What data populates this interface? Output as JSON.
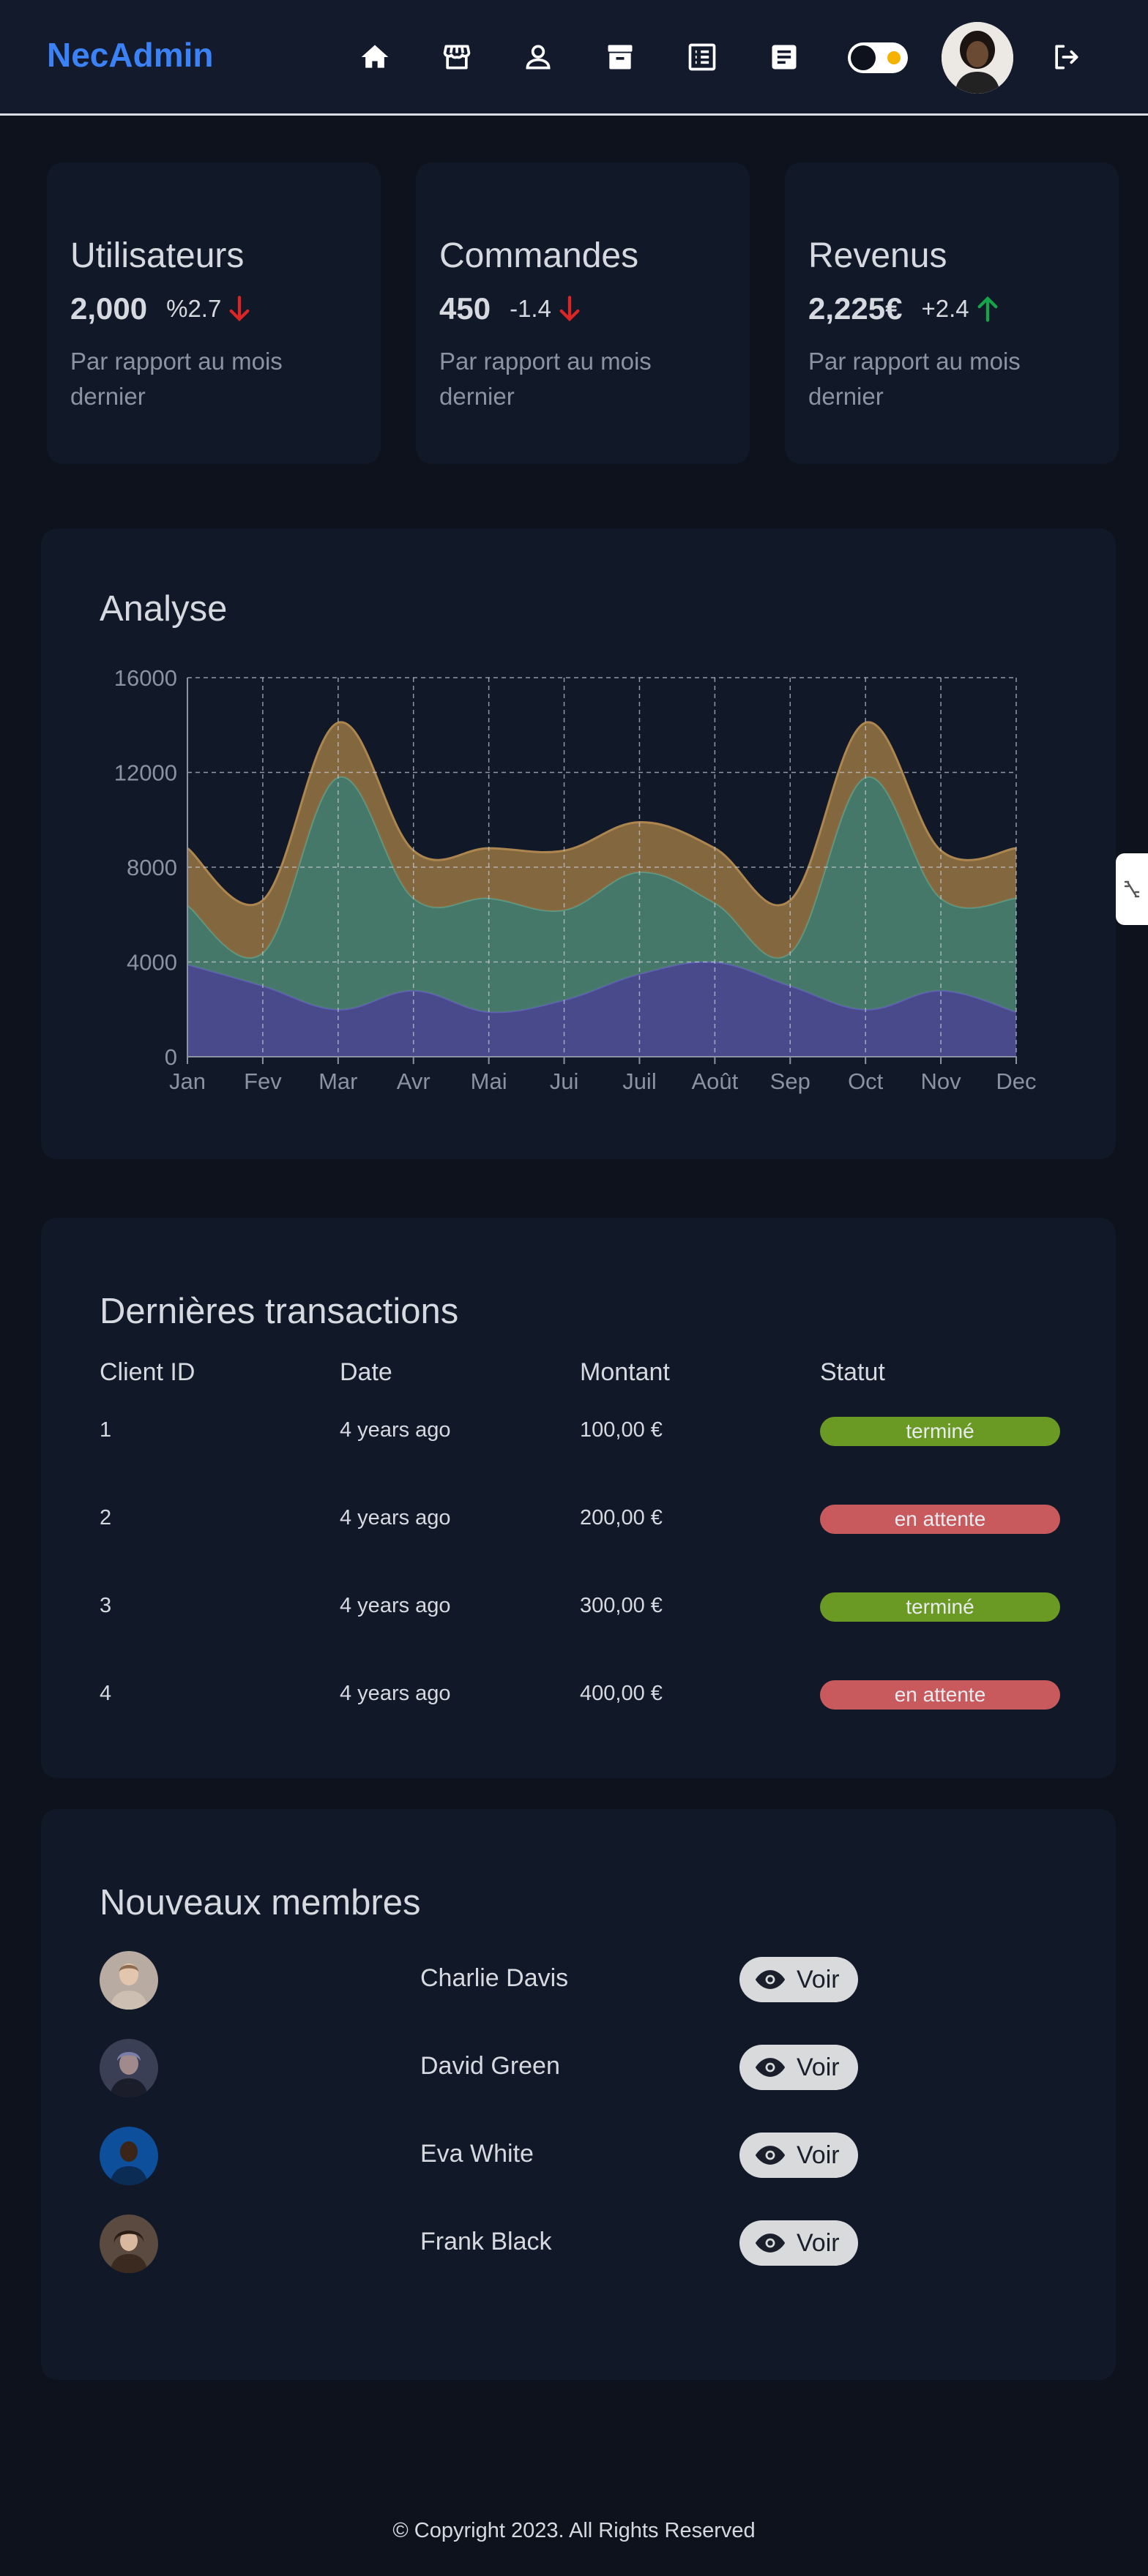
{
  "header": {
    "brand": "NecAdmin",
    "nav_icons": [
      "home-icon",
      "store-icon",
      "user-icon",
      "archive-icon",
      "list-icon",
      "document-icon"
    ],
    "theme_toggle": "dark",
    "logout_icon": "logout-icon"
  },
  "stats": [
    {
      "title": "Utilisateurs",
      "value": "2,000",
      "delta": "%2.7",
      "trend": "down",
      "note": "Par rapport au mois dernier"
    },
    {
      "title": "Commandes",
      "value": "450",
      "delta": "-1.4",
      "trend": "down",
      "note": "Par rapport au mois dernier"
    },
    {
      "title": "Revenus",
      "value": "2,225€",
      "delta": "+2.4",
      "trend": "up",
      "note": "Par rapport au mois dernier"
    }
  ],
  "analyse": {
    "title": "Analyse"
  },
  "chart_data": {
    "type": "area",
    "stacked": true,
    "title": "Analyse",
    "categories": [
      "Jan",
      "Fev",
      "Mar",
      "Avr",
      "Mai",
      "Jui",
      "Juil",
      "Août",
      "Sep",
      "Oct",
      "Nov",
      "Dec"
    ],
    "series": [
      {
        "values": [
          3900,
          3000,
          2000,
          2800,
          1900,
          2400,
          3500,
          4000,
          3000,
          2000,
          2800,
          1900
        ],
        "color": "#4d4d91"
      },
      {
        "values": [
          2500,
          1400,
          9800,
          3900,
          4800,
          3800,
          4300,
          2500,
          1400,
          9800,
          3900,
          4800
        ],
        "color": "#4a7d6e"
      },
      {
        "values": [
          2400,
          2200,
          2300,
          2000,
          2100,
          2500,
          2100,
          2300,
          2200,
          2300,
          2000,
          2100
        ],
        "color": "#8a6b3f"
      }
    ],
    "ylim": [
      0,
      16000
    ],
    "yticks": [
      "0",
      "4000",
      "8000",
      "12000",
      "16000"
    ],
    "grid": true
  },
  "transactions": {
    "title": "Dernières transactions",
    "headers": [
      "Client ID",
      "Date",
      "Montant",
      "Statut"
    ],
    "rows": [
      {
        "id": "1",
        "date": "4 years ago",
        "amount": "100,00 €",
        "status": "terminé",
        "status_color": "#6a9a23"
      },
      {
        "id": "2",
        "date": "4 years ago",
        "amount": "200,00 €",
        "status": "en attente",
        "status_color": "#c85a5e"
      },
      {
        "id": "3",
        "date": "4 years ago",
        "amount": "300,00 €",
        "status": "terminé",
        "status_color": "#6a9a23"
      },
      {
        "id": "4",
        "date": "4 years ago",
        "amount": "400,00 €",
        "status": "en attente",
        "status_color": "#c85a5e"
      }
    ]
  },
  "members": {
    "title": "Nouveaux membres",
    "button_label": "Voir",
    "list": [
      {
        "name": "Charlie Davis"
      },
      {
        "name": "David Green"
      },
      {
        "name": "Eva White"
      },
      {
        "name": "Frank Black"
      }
    ]
  },
  "footer": {
    "copyright": "© Copyright 2023. All Rights Reserved"
  }
}
